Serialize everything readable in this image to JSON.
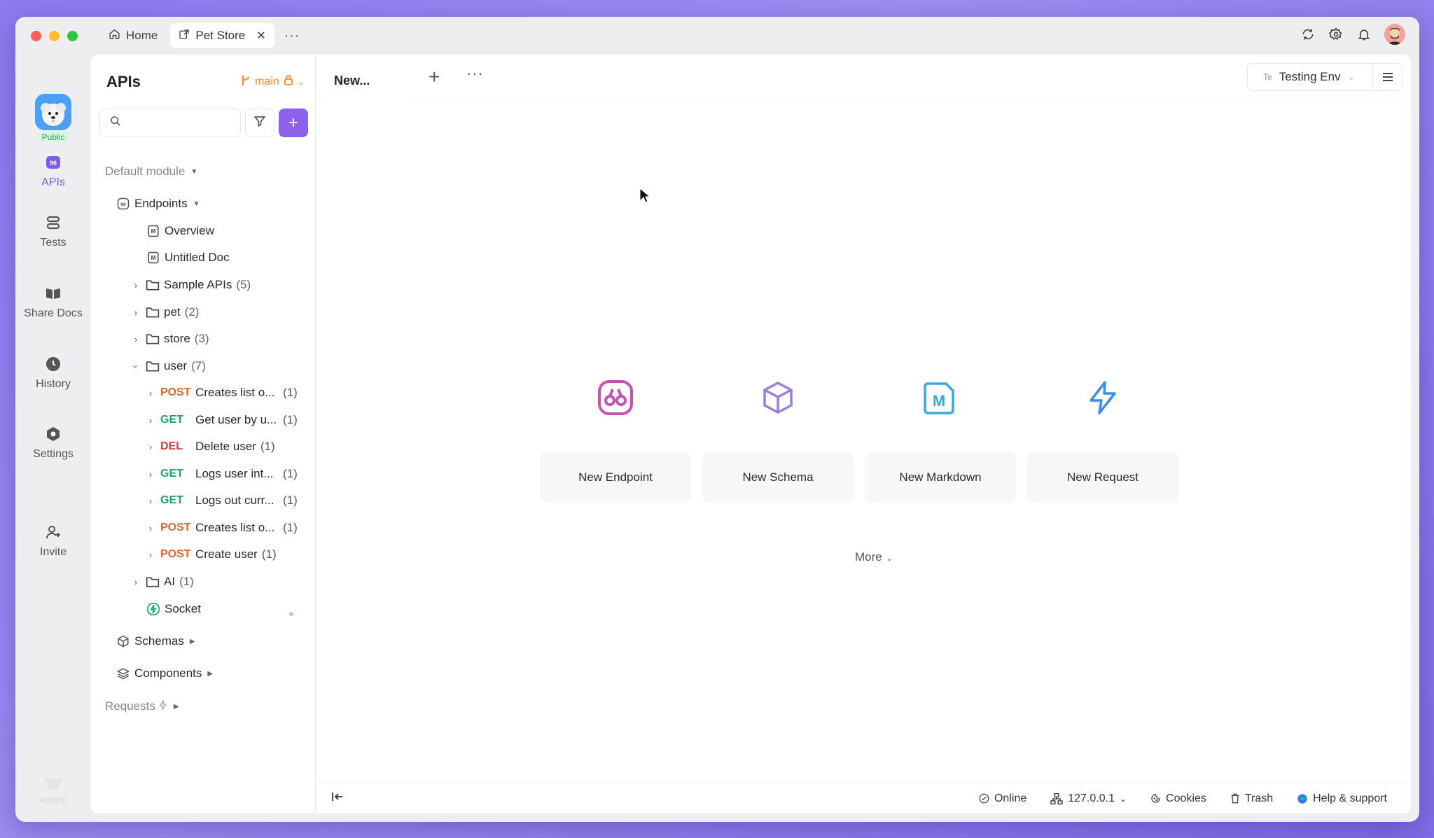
{
  "titlebar": {
    "home_tab": "Home",
    "active_tab": "Pet Store",
    "more": "···"
  },
  "rail": {
    "project_badge": "Public",
    "items": [
      {
        "label": "APIs",
        "icon": "apis-icon"
      },
      {
        "label": "Tests",
        "icon": "tests-icon"
      },
      {
        "label": "Share Docs",
        "icon": "share-docs-icon"
      },
      {
        "label": "History",
        "icon": "history-icon"
      },
      {
        "label": "Settings",
        "icon": "settings-icon"
      },
      {
        "label": "Invite",
        "icon": "invite-icon"
      }
    ],
    "logo_text": "Apidog"
  },
  "sidebar": {
    "title": "APIs",
    "branch": "main",
    "search_placeholder": "",
    "default_module": "Default module",
    "endpoints_label": "Endpoints",
    "docs": [
      "Overview",
      "Untitled Doc"
    ],
    "folders": [
      {
        "name": "Sample APIs",
        "count": "(5)"
      },
      {
        "name": "pet",
        "count": "(2)"
      },
      {
        "name": "store",
        "count": "(3)"
      },
      {
        "name": "user",
        "count": "(7)"
      }
    ],
    "user_endpoints": [
      {
        "method": "POST",
        "name": "Creates list o...",
        "count": "(1)"
      },
      {
        "method": "GET",
        "name": "Get user by u...",
        "count": "(1)"
      },
      {
        "method": "DEL",
        "name": "Delete user",
        "count": "(1)"
      },
      {
        "method": "GET",
        "name": "Logs user int...",
        "count": "(1)"
      },
      {
        "method": "GET",
        "name": "Logs out curr...",
        "count": "(1)"
      },
      {
        "method": "POST",
        "name": "Creates list o...",
        "count": "(1)"
      },
      {
        "method": "POST",
        "name": "Create user",
        "count": "(1)"
      }
    ],
    "ai_folder": {
      "name": "AI",
      "count": "(1)"
    },
    "socket": "Socket",
    "schemas": "Schemas",
    "components": "Components",
    "requests": "Requests"
  },
  "main": {
    "tab_label": "New...",
    "env_prefix": "Te",
    "env_name": "Testing Env",
    "actions": [
      {
        "label": "New Endpoint",
        "icon": "endpoint-icon"
      },
      {
        "label": "New Schema",
        "icon": "schema-cube-icon"
      },
      {
        "label": "New Markdown",
        "icon": "markdown-icon"
      },
      {
        "label": "New Request",
        "icon": "lightning-icon"
      }
    ],
    "more": "More"
  },
  "statusbar": {
    "online": "Online",
    "ip": "127.0.0.1",
    "cookies": "Cookies",
    "trash": "Trash",
    "help": "Help & support"
  },
  "colors": {
    "accent": "#8a63ea",
    "branch": "#f08a1c",
    "post": "#e0662a",
    "get": "#1aa66a",
    "del": "#e03a3a"
  }
}
